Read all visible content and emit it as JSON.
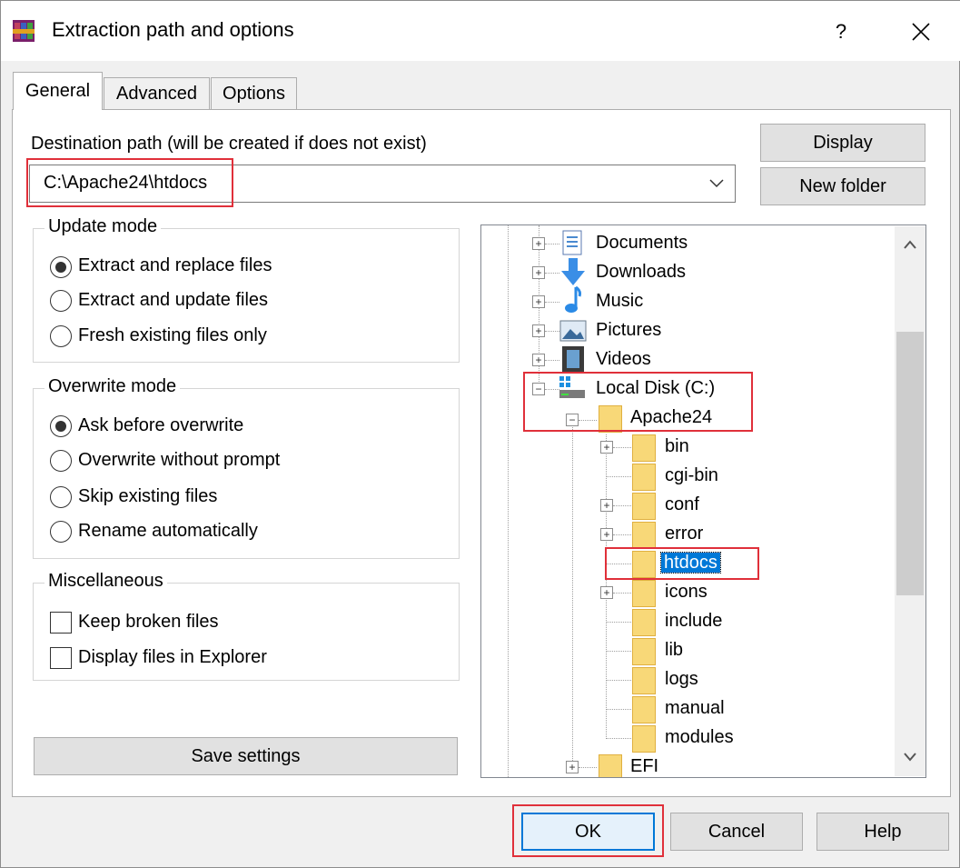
{
  "window": {
    "title": "Extraction path and options",
    "help_glyph": "?",
    "close_glyph": "✕"
  },
  "tabs": [
    {
      "label": "General",
      "active": true
    },
    {
      "label": "Advanced",
      "active": false
    },
    {
      "label": "Options",
      "active": false
    }
  ],
  "destination": {
    "label": "Destination path (will be created if does not exist)",
    "value": "C:\\Apache24\\htdocs"
  },
  "buttons": {
    "display": "Display",
    "new_folder": "New folder",
    "save_settings": "Save settings",
    "ok": "OK",
    "cancel": "Cancel",
    "help": "Help"
  },
  "update_mode": {
    "title": "Update mode",
    "options": [
      {
        "label": "Extract and replace files",
        "checked": true
      },
      {
        "label": "Extract and update files",
        "checked": false
      },
      {
        "label": "Fresh existing files only",
        "checked": false
      }
    ]
  },
  "overwrite_mode": {
    "title": "Overwrite mode",
    "options": [
      {
        "label": "Ask before overwrite",
        "checked": true
      },
      {
        "label": "Overwrite without prompt",
        "checked": false
      },
      {
        "label": "Skip existing files",
        "checked": false
      },
      {
        "label": "Rename automatically",
        "checked": false
      }
    ]
  },
  "misc": {
    "title": "Miscellaneous",
    "options": [
      {
        "label": "Keep broken files",
        "checked": false
      },
      {
        "label": "Display files in Explorer",
        "checked": false
      }
    ]
  },
  "tree": {
    "items": [
      {
        "label": "Documents",
        "icon": "documents-icon"
      },
      {
        "label": "Downloads",
        "icon": "downloads-icon"
      },
      {
        "label": "Music",
        "icon": "music-icon"
      },
      {
        "label": "Pictures",
        "icon": "pictures-icon"
      },
      {
        "label": "Videos",
        "icon": "videos-icon"
      },
      {
        "label": "Local Disk (C:)",
        "icon": "drive-icon"
      },
      {
        "label": "Apache24",
        "icon": "folder-icon"
      },
      {
        "label": "bin",
        "icon": "folder-icon"
      },
      {
        "label": "cgi-bin",
        "icon": "folder-icon"
      },
      {
        "label": "conf",
        "icon": "folder-icon"
      },
      {
        "label": "error",
        "icon": "folder-icon"
      },
      {
        "label": "htdocs",
        "icon": "folder-icon",
        "selected": true
      },
      {
        "label": "icons",
        "icon": "folder-icon"
      },
      {
        "label": "include",
        "icon": "folder-icon"
      },
      {
        "label": "lib",
        "icon": "folder-icon"
      },
      {
        "label": "logs",
        "icon": "folder-icon"
      },
      {
        "label": "manual",
        "icon": "folder-icon"
      },
      {
        "label": "modules",
        "icon": "folder-icon"
      },
      {
        "label": "EFI",
        "icon": "folder-icon"
      }
    ]
  },
  "colors": {
    "highlight": "#e0303a",
    "selection": "#0078d7"
  }
}
